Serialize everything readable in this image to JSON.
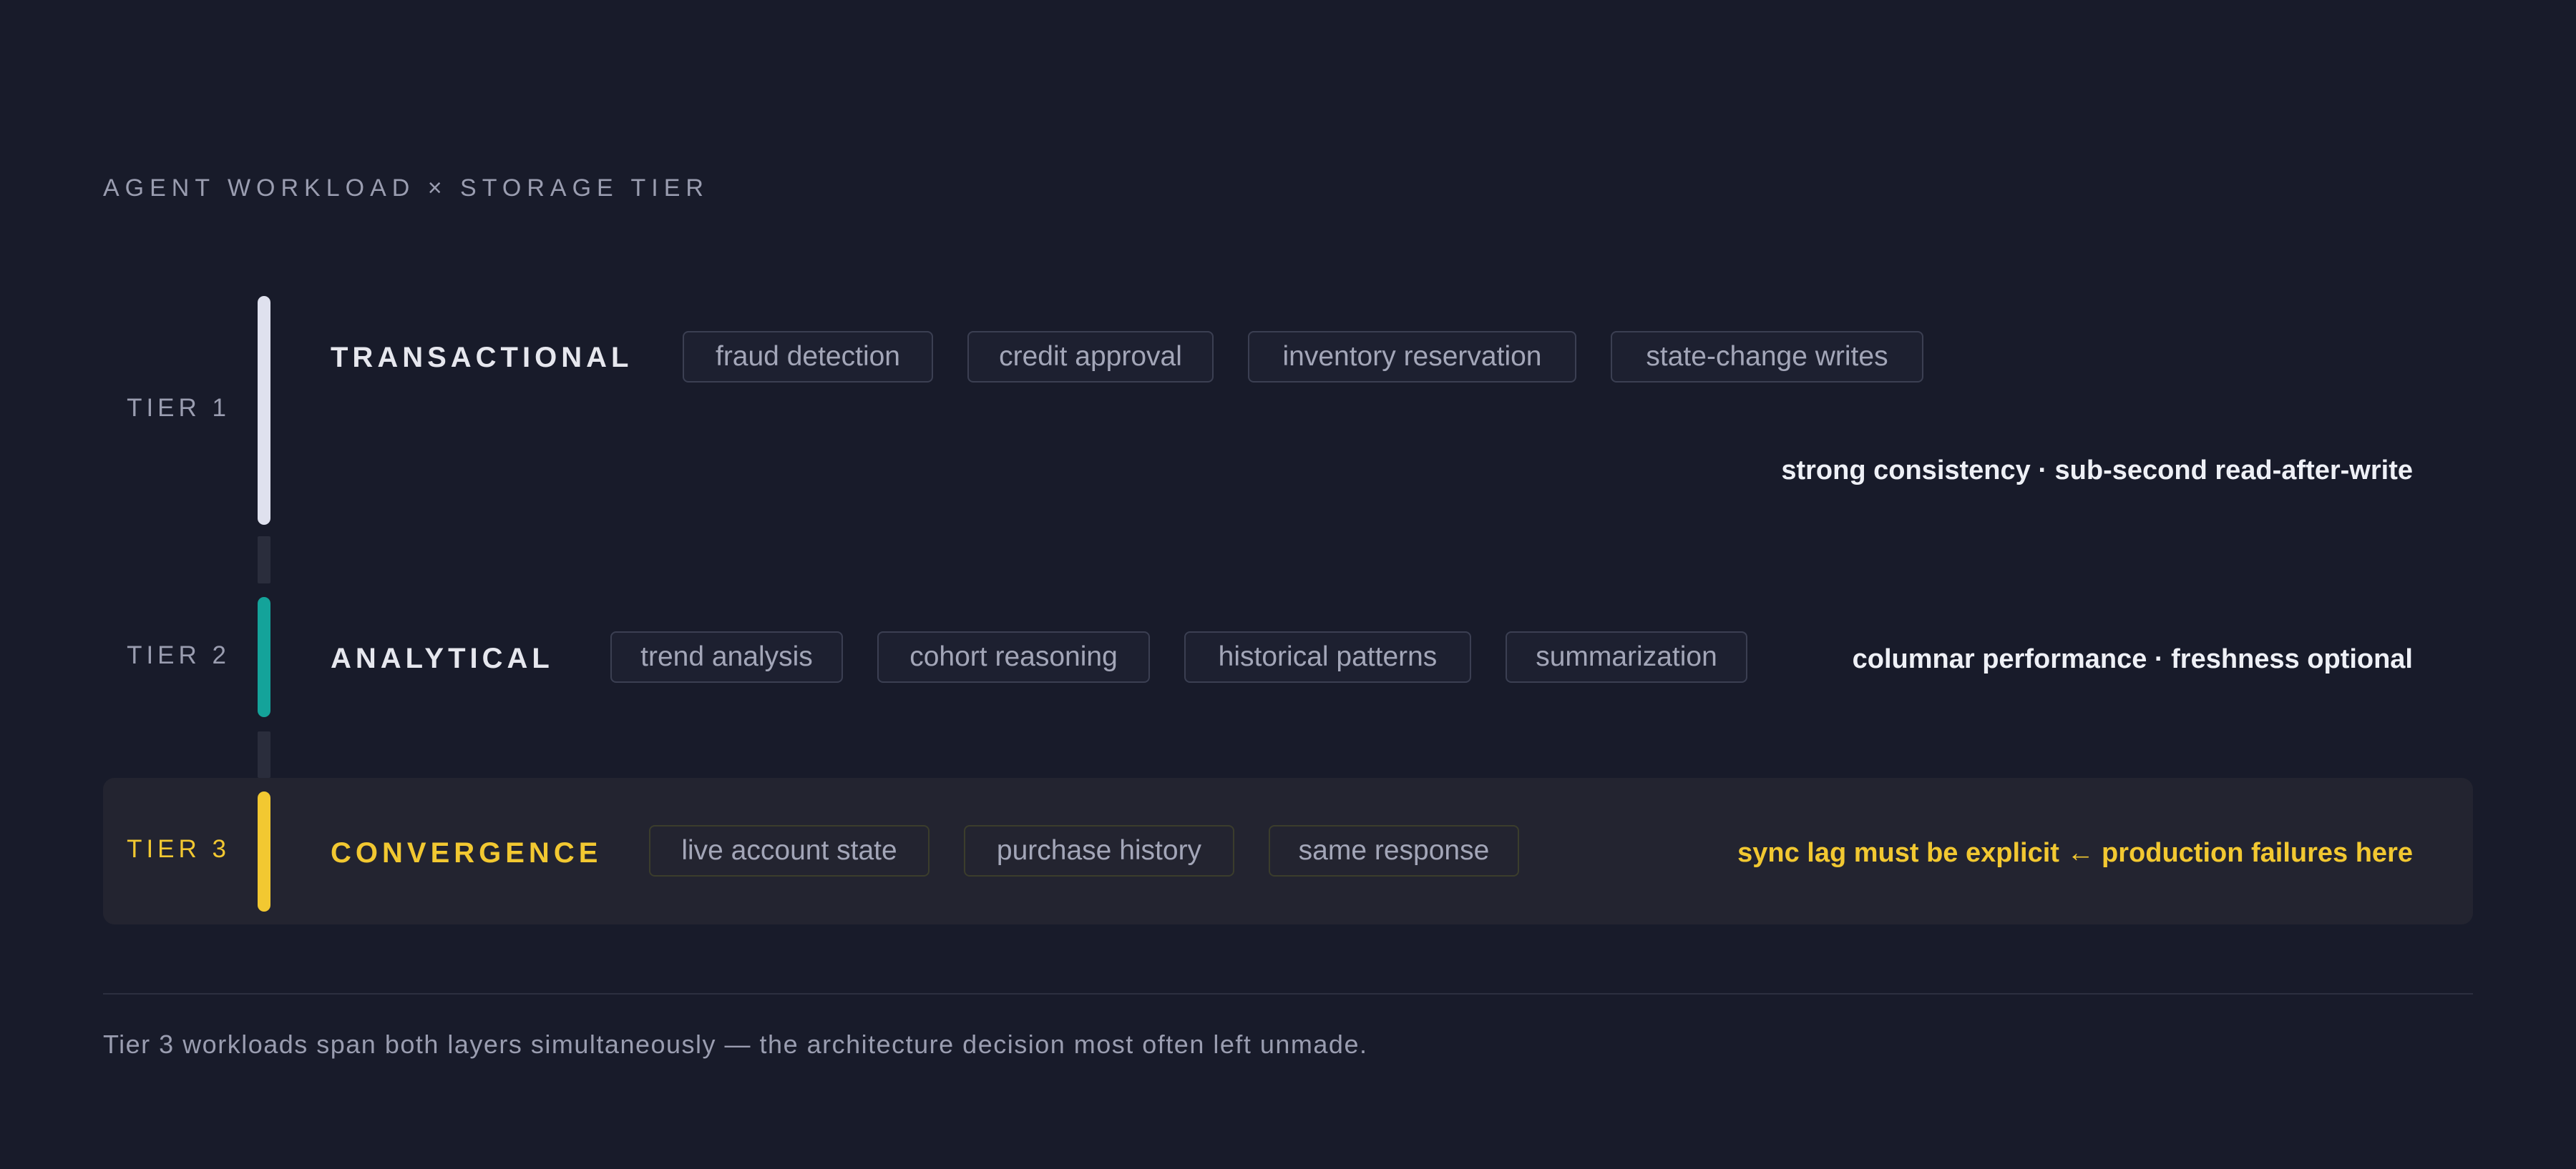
{
  "title": "AGENT WORKLOAD × STORAGE TIER",
  "colors": {
    "background": "#181b2a",
    "tier1_accent": "#dfe1ee",
    "tier2_accent": "#14a39a",
    "tier3_accent": "#f2c831",
    "muted_text": "#9a9db0"
  },
  "tiers": [
    {
      "label": "TIER 1",
      "name": "TRANSACTIONAL",
      "workloads": [
        "fraud detection",
        "credit approval",
        "inventory reservation",
        "state-change writes"
      ],
      "note": "strong consistency · sub-second read-after-write"
    },
    {
      "label": "TIER 2",
      "name": "ANALYTICAL",
      "workloads": [
        "trend analysis",
        "cohort reasoning",
        "historical patterns",
        "summarization"
      ],
      "note": "columnar performance · freshness optional"
    },
    {
      "label": "TIER 3",
      "name": "CONVERGENCE",
      "workloads": [
        "live account state",
        "purchase history",
        "same response"
      ],
      "note": "sync lag must be explicit ← production failures here"
    }
  ],
  "footnote": "Tier 3 workloads span both layers simultaneously — the architecture decision most often left unmade."
}
